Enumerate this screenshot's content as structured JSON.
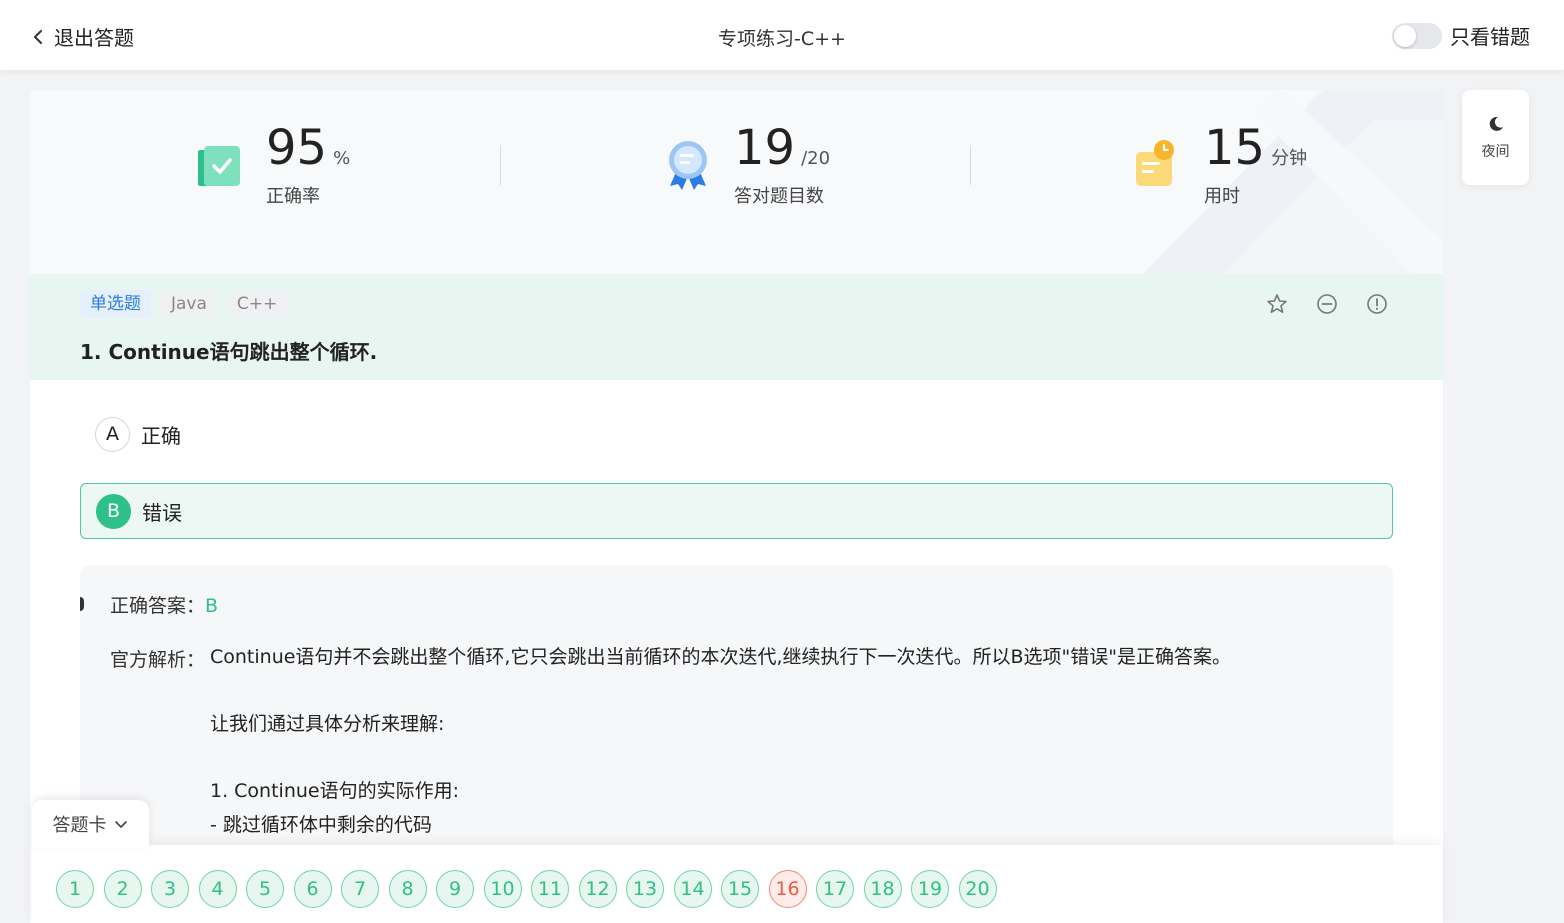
{
  "header": {
    "back_label": "退出答题",
    "title": "专项练习-C++",
    "toggle_label": "只看错题",
    "toggle_on": false
  },
  "stats": {
    "accuracy": {
      "value": "95",
      "unit": "%",
      "caption": "正确率"
    },
    "correct": {
      "value": "19",
      "unit": "/20",
      "caption": "答对题目数"
    },
    "time": {
      "value": "15",
      "unit": "分钟",
      "caption": "用时"
    }
  },
  "question": {
    "tags": [
      "单选题",
      "Java",
      "C++"
    ],
    "title": "1. Continue语句跳出整个循环.",
    "options": [
      {
        "letter": "A",
        "text": "正确"
      },
      {
        "letter": "B",
        "text": "错误"
      }
    ],
    "selected": "B"
  },
  "analysis": {
    "answer_label": "正确答案：",
    "answer_value": "B",
    "explanation_label": "官方解析：",
    "explanation_lines": [
      "Continue语句并不会跳出整个循环,它只会跳出当前循环的本次迭代,继续执行下一次迭代。所以B选项\"错误\"是正确答案。",
      "",
      "让我们通过具体分析来理解:",
      "",
      "1. Continue语句的实际作用:",
      "- 跳过循环体中剩余的代码"
    ]
  },
  "answer_card": {
    "label": "答题卡",
    "numbers": [
      "1",
      "2",
      "3",
      "4",
      "5",
      "6",
      "7",
      "8",
      "9",
      "10",
      "11",
      "12",
      "13",
      "14",
      "15",
      "16",
      "17",
      "18",
      "19",
      "20"
    ],
    "wrong": [
      "16"
    ]
  },
  "side": {
    "night_label": "夜间"
  },
  "colors": {
    "accent_green": "#2ec08b",
    "wrong_red": "#f05a3f",
    "question_bg": "#e8f6f1",
    "tag_blue": "#2a7de1"
  }
}
